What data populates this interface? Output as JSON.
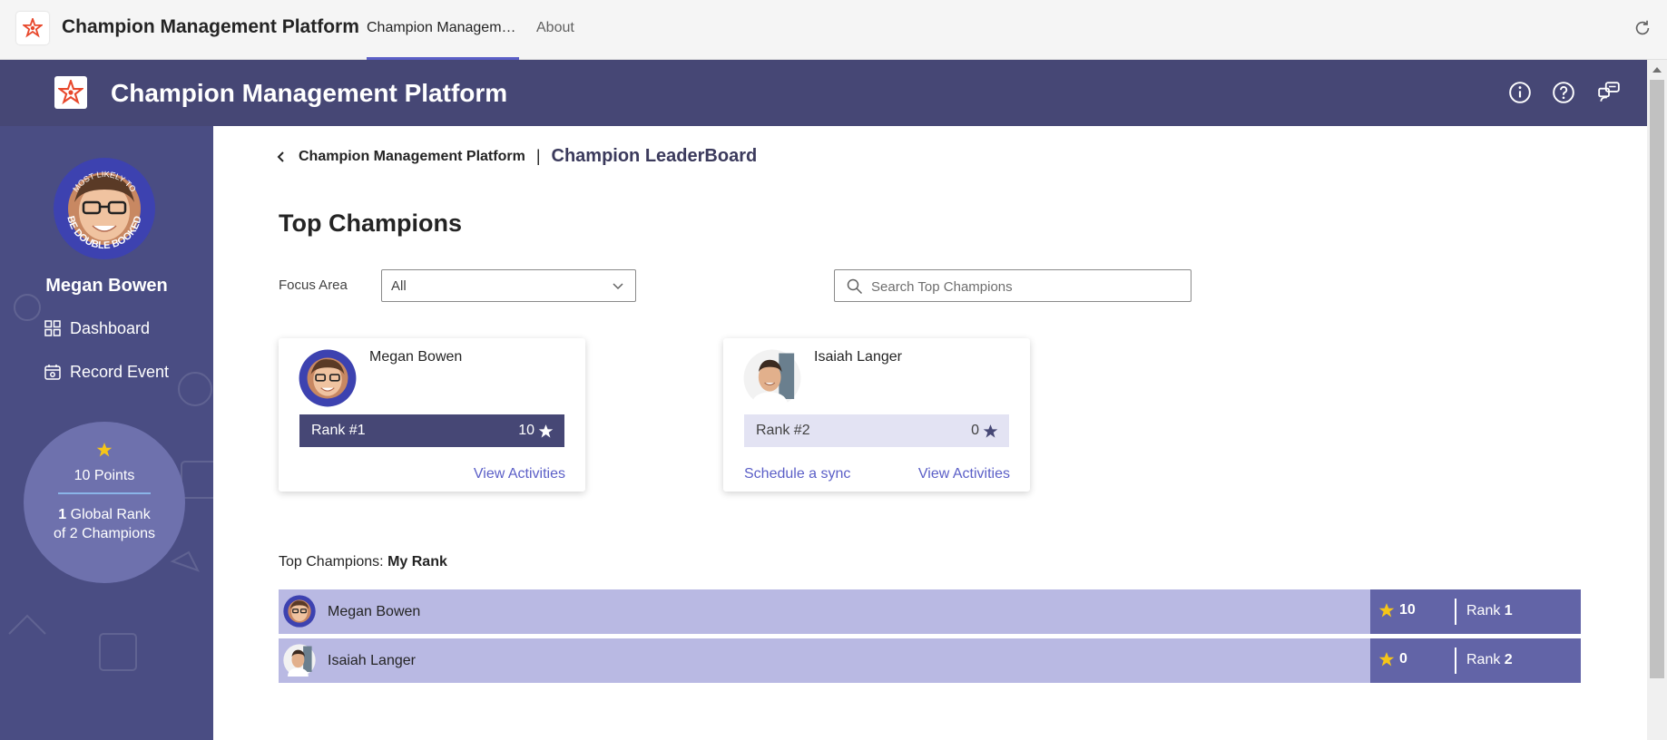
{
  "teams": {
    "app_name": "Champion Management Platform",
    "tabs": [
      {
        "label": "Champion Management Platform",
        "active": true
      },
      {
        "label": "About",
        "active": false
      }
    ],
    "refresh_icon": "refresh-icon"
  },
  "header": {
    "title": "Champion Management Platform",
    "icons": [
      "info-icon",
      "help-icon",
      "feedback-icon"
    ]
  },
  "sidebar": {
    "avatar_badge_top": "MOST LIKELY TO",
    "avatar_badge_bottom": "BE DOUBLE BOOKED",
    "user_name": "Megan Bowen",
    "nav": [
      {
        "label": "Dashboard",
        "icon": "dashboard-icon"
      },
      {
        "label": "Record Event",
        "icon": "calendar-icon"
      }
    ],
    "points": "10 Points",
    "rank_number": "1",
    "rank_suffix": " Global Rank",
    "rank_of": "of 2 Champions"
  },
  "breadcrumb": {
    "parent": "Champion Management Platform",
    "separator": "|",
    "current": "Champion LeaderBoard"
  },
  "page_title": "Top Champions",
  "filter": {
    "label": "Focus Area",
    "selected": "All"
  },
  "search": {
    "placeholder": "Search Top Champions"
  },
  "cards": [
    {
      "name": "Megan Bowen",
      "rank": "Rank #1",
      "score": "10",
      "links": [
        "View Activities"
      ]
    },
    {
      "name": "Isaiah Langer",
      "rank": "Rank #2",
      "score": "0",
      "links": [
        "Schedule a sync",
        "View Activities"
      ]
    }
  ],
  "my_rank": {
    "label_prefix": "Top Champions: ",
    "label_bold": "My Rank",
    "rows": [
      {
        "name": "Megan Bowen",
        "points": "10",
        "rank_label": "Rank ",
        "rank": "1"
      },
      {
        "name": "Isaiah Langer",
        "points": "0",
        "rank_label": "Rank ",
        "rank": "2"
      }
    ]
  },
  "colors": {
    "header_bg": "#464775",
    "sidebar_bg": "#4a4d83",
    "accent": "#5b5fc7",
    "rank_bar_dark": "#464775",
    "rank_bar_light": "#e3e3f3",
    "row_bg": "#b9b9e3",
    "row_score_bg": "#6264a7",
    "star": "#f5c518"
  }
}
